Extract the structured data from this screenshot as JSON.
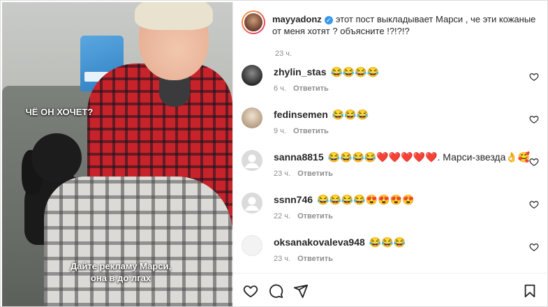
{
  "media": {
    "caption_top": "ЧЁ ОН ХОЧЕТ?",
    "caption_bottom_line1": "Дайте рекламу Марси,",
    "caption_bottom_line2": "она в до лгах"
  },
  "post": {
    "username": "mayyadonz",
    "verified": true,
    "text": "этот пост выкладывает Марси , че эти кожаные от меня хотят ? объясните !?!?!?",
    "time": "23 ч."
  },
  "comments": [
    {
      "user": "zhylin_stas",
      "text": "😂😂😂😂",
      "time": "6 ч.",
      "reply": "Ответить",
      "avatar_color": "#2b2b2b"
    },
    {
      "user": "fedinsemen",
      "text": "😂😂😂",
      "time": "9 ч.",
      "reply": "Ответить",
      "avatar_color": "#c7b7a1"
    },
    {
      "user": "sanna8815",
      "text": "😂😂😂😂❤️❤️❤️❤️❤️. Марси-звезда👌🥰",
      "time": "23 ч.",
      "reply": "Ответить",
      "avatar_color": "#dbdbdb"
    },
    {
      "user": "ssnn746",
      "text": "😂😂😂😂😍😍😍😍",
      "time": "22 ч.",
      "reply": "Ответить",
      "avatar_color": "#dbdbdb"
    },
    {
      "user": "oksanakovaleva948",
      "text": "😂😂😂",
      "time": "23 ч.",
      "reply": "Ответить",
      "avatar_color": "#f0f0f0"
    }
  ],
  "icons": {
    "like": "heart-icon",
    "comment": "comment-icon",
    "share": "share-icon",
    "save": "bookmark-icon"
  },
  "colors": {
    "verified": "#3897f0",
    "meta_text": "#8e8e8e",
    "primary_text": "#262626"
  }
}
